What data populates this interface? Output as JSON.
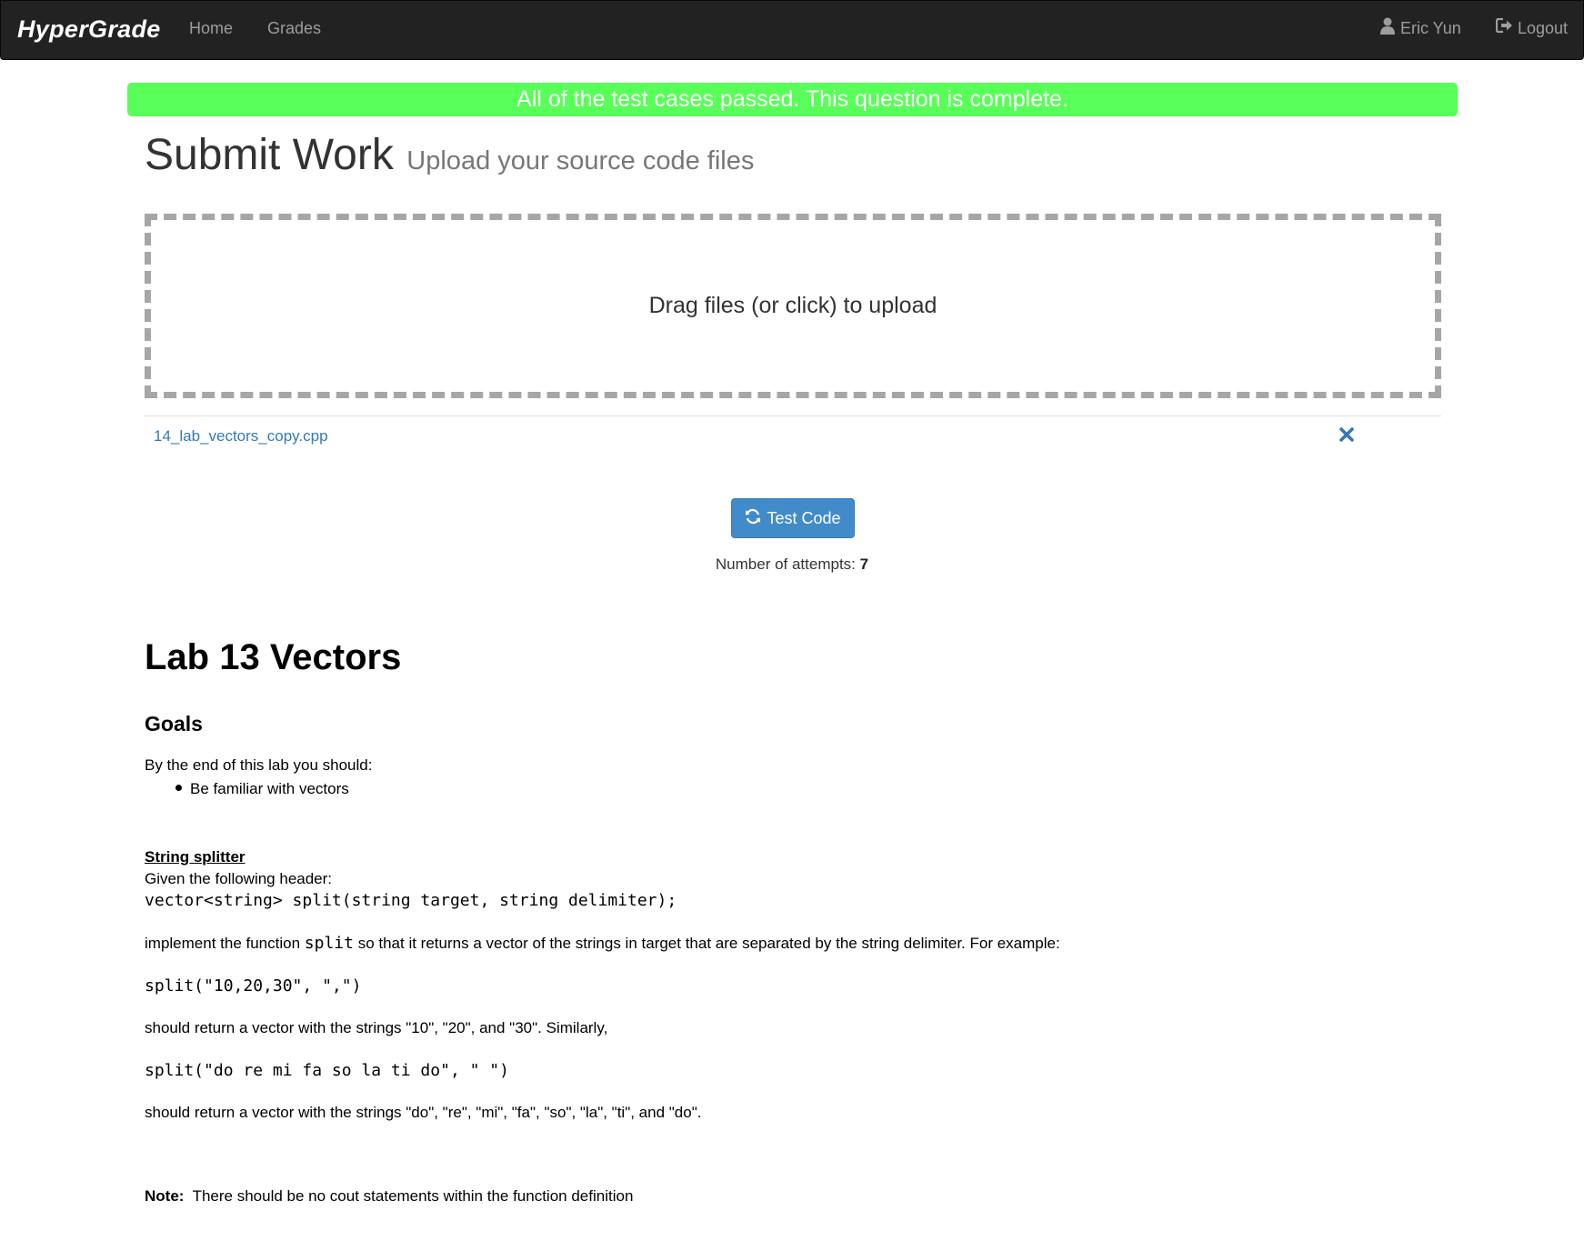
{
  "navbar": {
    "brand": "HyperGrade",
    "links": [
      "Home",
      "Grades"
    ],
    "user": "Eric Yun",
    "logout": "Logout"
  },
  "alert": "All of the test cases passed. This question is complete.",
  "header": {
    "title": "Submit Work",
    "subtitle": "Upload your source code files"
  },
  "dropzone": {
    "text": "Drag files (or click) to upload"
  },
  "files": [
    {
      "name": "14_lab_vectors_copy.cpp"
    }
  ],
  "test_button": {
    "label": "Test Code"
  },
  "attempts": {
    "label": "Number of attempts:",
    "count": "7"
  },
  "lab": {
    "title": "Lab 13 Vectors",
    "goals_heading": "Goals",
    "goals_intro": "By the end of this lab you should:",
    "goals": [
      "Be familiar with vectors"
    ],
    "section_title": "String splitter",
    "given": "Given the following header:",
    "header_code": "vector<string> split(string target, string delimiter);",
    "implement_pre": "implement the function",
    "implement_code": "split",
    "implement_post": "so that it returns a vector of the strings in target that are separated by the string delimiter. For example:",
    "example1": "split(\"10,20,30\", \",\")",
    "result1": "should return a vector with the strings \"10\", \"20\", and \"30\". Similarly,",
    "example2": "split(\"do re mi fa so la ti do\", \" \")",
    "result2": "should return a vector with the strings \"do\", \"re\", \"mi\", \"fa\", \"so\", \"la\", \"ti\", and \"do\".",
    "note_label": "Note:",
    "note_text": "There should be no cout statements within the function definition"
  },
  "colors": {
    "navbar_bg": "#222222",
    "alert_bg": "#58ff58",
    "primary": "#428bca",
    "link": "#337ab7"
  }
}
